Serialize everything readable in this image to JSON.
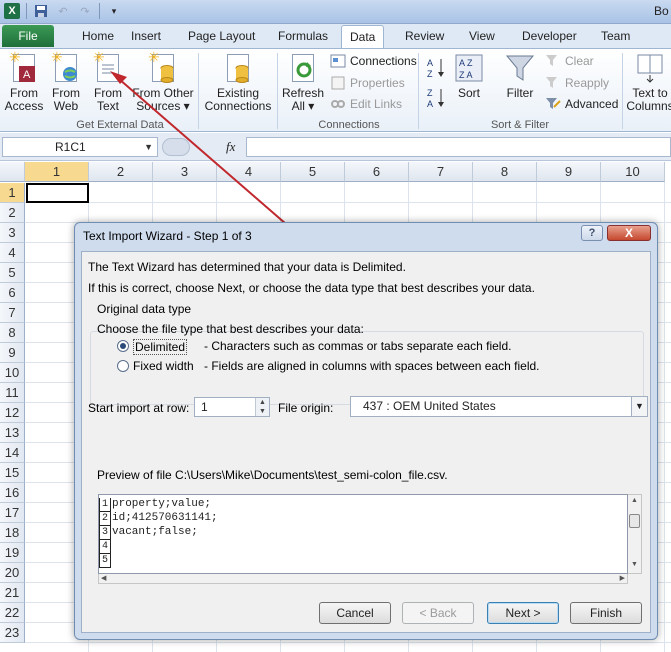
{
  "window": {
    "title_right": "Bo"
  },
  "tabs": {
    "file": "File",
    "items": [
      "Home",
      "Insert",
      "Page Layout",
      "Formulas",
      "Data",
      "Review",
      "View",
      "Developer",
      "Team"
    ],
    "active": "Data"
  },
  "ribbon": {
    "get_external": {
      "from_access": [
        "From",
        "Access"
      ],
      "from_web": [
        "From",
        "Web"
      ],
      "from_text": [
        "From",
        "Text"
      ],
      "from_other": [
        "From Other",
        "Sources ▾"
      ],
      "existing": [
        "Existing",
        "Connections"
      ],
      "group_label": "Get External Data"
    },
    "connections": {
      "refresh": [
        "Refresh",
        "All ▾"
      ],
      "connections": "Connections",
      "properties": "Properties",
      "edit_links": "Edit Links",
      "group_label": "Connections"
    },
    "sort_filter": {
      "sort": "Sort",
      "filter": "Filter",
      "clear": "Clear",
      "reapply": "Reapply",
      "advanced": "Advanced",
      "group_label": "Sort & Filter"
    },
    "data_tools": {
      "text_to_columns": [
        "Text to",
        "Columns"
      ]
    }
  },
  "formula_bar": {
    "name_box": "R1C1",
    "fx": "fx",
    "value": ""
  },
  "grid": {
    "columns": [
      "1",
      "2",
      "3",
      "4",
      "5",
      "6",
      "7",
      "8",
      "9",
      "10"
    ],
    "rows": [
      "1",
      "2",
      "3",
      "4",
      "5",
      "6",
      "7",
      "8",
      "9",
      "10",
      "11",
      "12",
      "13",
      "14",
      "15",
      "16",
      "17",
      "18",
      "19",
      "20",
      "21",
      "22",
      "23"
    ]
  },
  "dialog": {
    "title": "Text Import Wizard - Step 1 of 3",
    "help": "?",
    "close": "X",
    "line1": "The Text Wizard has determined that your data is Delimited.",
    "line2": "If this is correct, choose Next, or choose the data type that best describes your data.",
    "group_title": "Original data type",
    "choose_label": "Choose the file type that best describes your data:",
    "options": [
      {
        "label": "Delimited",
        "desc": "- Characters such as commas or tabs separate each field.",
        "selected": true
      },
      {
        "label": "Fixed width",
        "desc": "- Fields are aligned in columns with spaces between each field.",
        "selected": false
      }
    ],
    "start_row_label": "Start import at row:",
    "start_row_value": "1",
    "file_origin_label": "File origin:",
    "file_origin_value": "437 : OEM United States",
    "preview_label": "Preview of file C:\\Users\\Mike\\Documents\\test_semi-colon_file.csv.",
    "preview_lines": [
      {
        "num": "1",
        "text": "property;value;"
      },
      {
        "num": "2",
        "text": "id;412570631141;"
      },
      {
        "num": "3",
        "text": "vacant;false;"
      },
      {
        "num": "4",
        "text": ""
      },
      {
        "num": "5",
        "text": ""
      }
    ],
    "buttons": {
      "cancel": "Cancel",
      "back": "< Back",
      "next": "Next >",
      "finish": "Finish"
    }
  },
  "colors": {
    "accent": "#217346",
    "arrow": "#c0282d",
    "dialog_frame": "#cfdcee"
  }
}
